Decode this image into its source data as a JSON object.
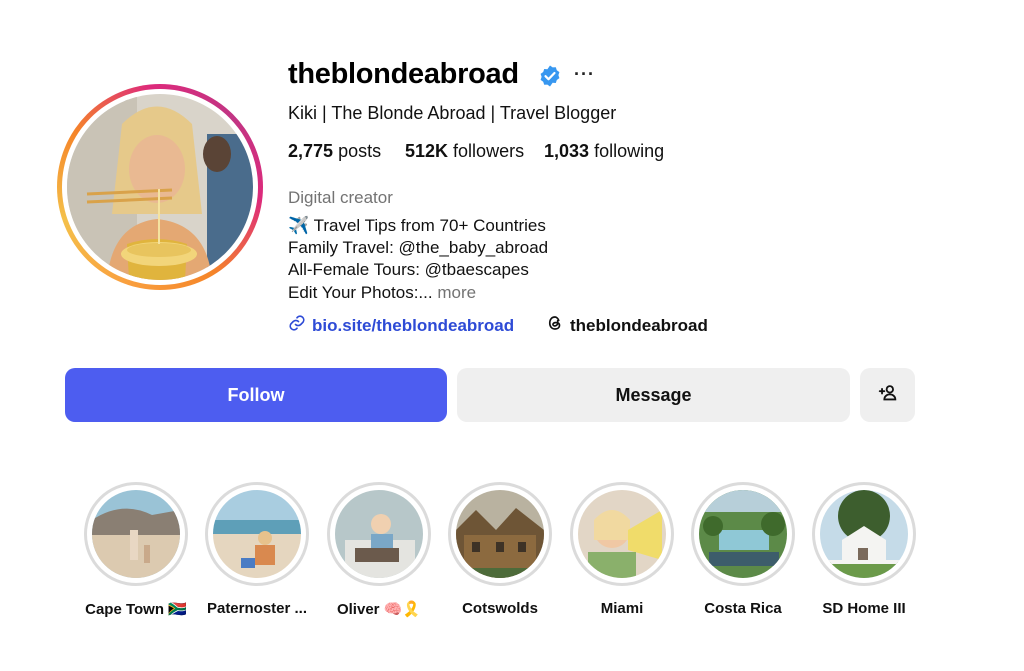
{
  "profile": {
    "username": "theblondeabroad",
    "full_name": "Kiki | The Blonde Abroad | Travel Blogger",
    "verified": true
  },
  "stats": {
    "posts_count": "2,775",
    "posts_label": "posts",
    "followers_count": "512K",
    "followers_label": "followers",
    "following_count": "1,033",
    "following_label": "following"
  },
  "bio": {
    "category": "Digital creator",
    "lines": [
      "✈️ Travel Tips from 70+ Countries",
      "Family Travel: @the_baby_abroad",
      "All-Female Tours: @tbaescapes",
      "Edit Your Photos:..."
    ],
    "more_label": "more",
    "link_text": "bio.site/theblondeabroad",
    "threads_handle": "theblondeabroad"
  },
  "actions": {
    "follow_label": "Follow",
    "message_label": "Message",
    "follow_color": "#4d5df0"
  },
  "highlights": [
    {
      "label": "Cape Town 🇿🇦"
    },
    {
      "label": "Paternoster ..."
    },
    {
      "label": "Oliver 🧠🎗️"
    },
    {
      "label": "Cotswolds"
    },
    {
      "label": "Miami"
    },
    {
      "label": "Costa Rica"
    },
    {
      "label": "SD Home III"
    }
  ],
  "icons": {
    "verified": "verified-badge-icon",
    "more": "more-options-icon",
    "link": "link-icon",
    "threads": "threads-icon",
    "suggest": "add-person-icon"
  }
}
